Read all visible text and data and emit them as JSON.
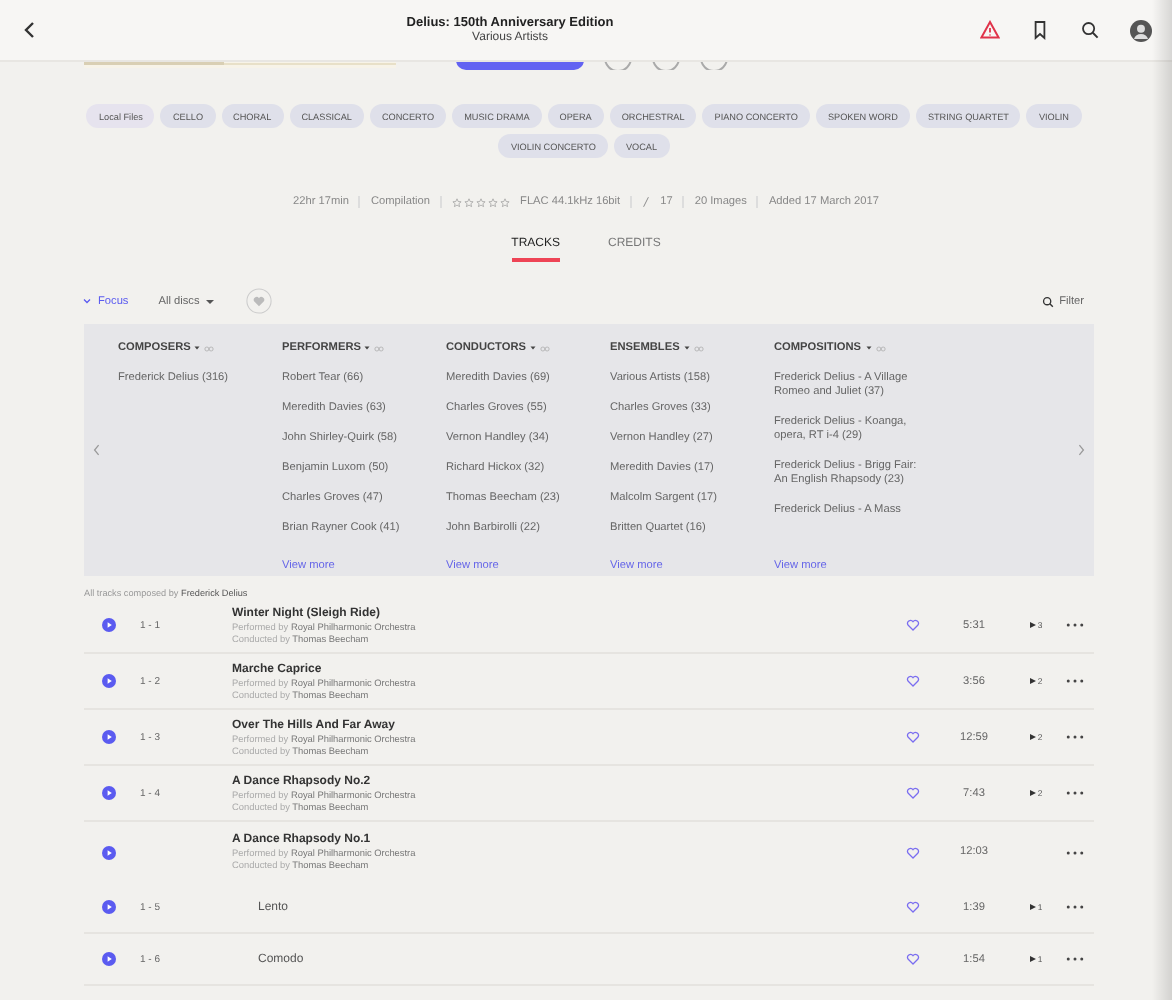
{
  "header": {
    "title": "Delius: 150th Anniversary Edition",
    "subtitle": "Various Artists"
  },
  "tags": [
    {
      "label": "Local Files",
      "kind": "source"
    },
    {
      "label": "CELLO",
      "kind": "genre"
    },
    {
      "label": "CHORAL",
      "kind": "genre"
    },
    {
      "label": "CLASSICAL",
      "kind": "genre"
    },
    {
      "label": "CONCERTO",
      "kind": "genre"
    },
    {
      "label": "MUSIC DRAMA",
      "kind": "genre"
    },
    {
      "label": "OPERA",
      "kind": "genre"
    },
    {
      "label": "ORCHESTRAL",
      "kind": "genre"
    },
    {
      "label": "PIANO CONCERTO",
      "kind": "genre"
    },
    {
      "label": "SPOKEN WORD",
      "kind": "genre"
    },
    {
      "label": "STRING QUARTET",
      "kind": "genre"
    },
    {
      "label": "VIOLIN",
      "kind": "genre"
    },
    {
      "label": "VIOLIN CONCERTO",
      "kind": "genre"
    },
    {
      "label": "VOCAL",
      "kind": "genre"
    }
  ],
  "meta": {
    "duration": "22hr 17min",
    "type": "Compilation",
    "stars": 0,
    "format": "FLAC 44.1kHz 16bit",
    "rating_count": "17",
    "images": "20 Images",
    "added": "Added 17 March 2017"
  },
  "tabs": [
    {
      "label": "TRACKS",
      "selected": true
    },
    {
      "label": "CREDITS",
      "selected": false
    }
  ],
  "toolbar": {
    "focus": "Focus",
    "discs": "All discs",
    "filter": "Filter"
  },
  "focus_columns": [
    {
      "heading": "COMPOSERS",
      "items": [
        "Frederick Delius (316)"
      ]
    },
    {
      "heading": "PERFORMERS",
      "items": [
        "Robert Tear (66)",
        "Meredith Davies (63)",
        "John Shirley-Quirk (58)",
        "Benjamin Luxom (50)",
        "Charles Groves (47)",
        "Brian Rayner Cook (41)"
      ],
      "more": "View more"
    },
    {
      "heading": "CONDUCTORS",
      "items": [
        "Meredith Davies (69)",
        "Charles Groves (55)",
        "Vernon Handley (34)",
        "Richard Hickox (32)",
        "Thomas Beecham (23)",
        "John Barbirolli (22)"
      ],
      "more": "View more"
    },
    {
      "heading": "ENSEMBLES",
      "items": [
        "Various Artists (158)",
        "Charles Groves (33)",
        "Vernon Handley (27)",
        "Meredith Davies (17)",
        "Malcolm Sargent (17)",
        "Britten Quartet (16)"
      ],
      "more": "View more"
    },
    {
      "heading": "COMPOSITIONS",
      "items": [
        "Frederick Delius - A Village Romeo and Juliet (37)",
        "Frederick Delius - Koanga, opera, RT i-4 (29)",
        "Frederick Delius - Brigg Fair: An English Rhapsody (23)",
        "Frederick Delius - A Mass"
      ],
      "more": "View more"
    }
  ],
  "caption": "All tracks composed by **Frederick Delius**",
  "tracks": [
    {
      "kind": "track",
      "number": "1 - 1",
      "title": "Winter Night (Sleigh Ride)",
      "performer": "Performed by **Royal Philharmonic Orchestra**",
      "conductor": "Conducted by **Thomas Beecham**",
      "duration": "5:31",
      "plays": "3"
    },
    {
      "kind": "track",
      "number": "1 - 2",
      "title": "Marche Caprice",
      "performer": "Performed by **Royal Philharmonic Orchestra**",
      "conductor": "Conducted by **Thomas Beecham**",
      "duration": "3:56",
      "plays": "2"
    },
    {
      "kind": "track",
      "number": "1 - 3",
      "title": "Over The Hills And Far Away",
      "performer": "Performed by **Royal Philharmonic Orchestra**",
      "conductor": "Conducted by **Thomas Beecham**",
      "duration": "12:59",
      "plays": "2"
    },
    {
      "kind": "track",
      "number": "1 - 4",
      "title": "A Dance Rhapsody No.2",
      "performer": "Performed by **Royal Philharmonic Orchestra**",
      "conductor": "Conducted by **Thomas Beecham**",
      "duration": "7:43",
      "plays": "2"
    },
    {
      "kind": "work",
      "title": "A Dance Rhapsody No.1",
      "performer": "Performed by **Royal Philharmonic Orchestra**",
      "conductor": "Conducted by **Thomas Beecham**",
      "duration": "12:03"
    },
    {
      "kind": "movement",
      "number": "1 - 5",
      "title": "Lento",
      "duration": "1:39",
      "plays": "1"
    },
    {
      "kind": "movement",
      "number": "1 - 6",
      "title": "Comodo",
      "duration": "1:54",
      "plays": "1"
    }
  ]
}
